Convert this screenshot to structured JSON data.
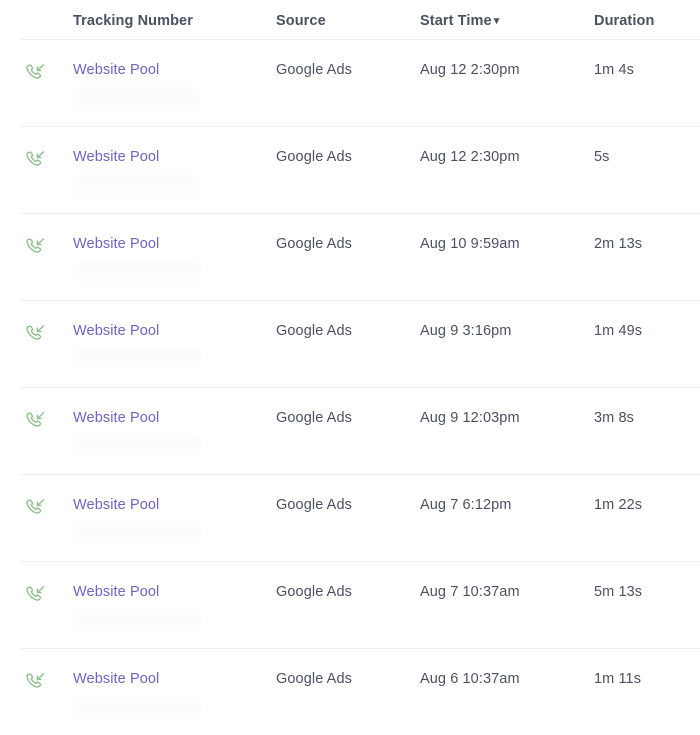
{
  "table": {
    "columns": [
      {
        "key": "icon",
        "label": ""
      },
      {
        "key": "tracking",
        "label": "Tracking Number"
      },
      {
        "key": "source",
        "label": "Source"
      },
      {
        "key": "start",
        "label": "Start Time"
      },
      {
        "key": "duration",
        "label": "Duration"
      }
    ],
    "sort": {
      "column": "Start Time",
      "direction": "descending",
      "caret": "▼"
    },
    "colors": {
      "link": "#6f63c4",
      "text": "#4a5160",
      "icon_green": "#8cc08c",
      "divider": "#edeef0",
      "background": "#ffffff"
    },
    "icon_name": "incoming-call-icon",
    "rows": [
      {
        "icon": "incoming-call-icon",
        "tracking": "Website Pool",
        "source": "Google Ads",
        "start": "Aug 12 2:30pm",
        "duration": "1m 4s"
      },
      {
        "icon": "incoming-call-icon",
        "tracking": "Website Pool",
        "source": "Google Ads",
        "start": "Aug 12 2:30pm",
        "duration": "5s"
      },
      {
        "icon": "incoming-call-icon",
        "tracking": "Website Pool",
        "source": "Google Ads",
        "start": "Aug 10 9:59am",
        "duration": "2m 13s"
      },
      {
        "icon": "incoming-call-icon",
        "tracking": "Website Pool",
        "source": "Google Ads",
        "start": "Aug 9 3:16pm",
        "duration": "1m 49s"
      },
      {
        "icon": "incoming-call-icon",
        "tracking": "Website Pool",
        "source": "Google Ads",
        "start": "Aug 9 12:03pm",
        "duration": "3m 8s"
      },
      {
        "icon": "incoming-call-icon",
        "tracking": "Website Pool",
        "source": "Google Ads",
        "start": "Aug 7 6:12pm",
        "duration": "1m 22s"
      },
      {
        "icon": "incoming-call-icon",
        "tracking": "Website Pool",
        "source": "Google Ads",
        "start": "Aug 7 10:37am",
        "duration": "5m 13s"
      },
      {
        "icon": "incoming-call-icon",
        "tracking": "Website Pool",
        "source": "Google Ads",
        "start": "Aug 6 10:37am",
        "duration": "1m 11s"
      }
    ]
  }
}
